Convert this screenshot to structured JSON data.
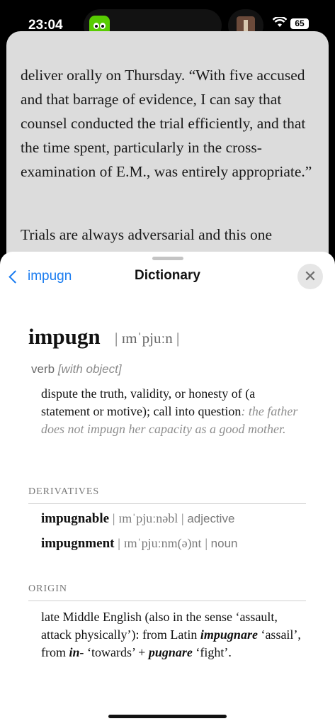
{
  "status": {
    "time": "23:04",
    "battery": "65"
  },
  "article": {
    "p1": "deliver orally on Thursday. “With five accused and that barrage of evidence, I can say that counsel conducted the trial efficiently, and that the time spent, particularly in the cross-examination of E.M., was entirely appropriate.”",
    "p2": "Trials are always adversarial and this one"
  },
  "sheet": {
    "back_label": "impugn",
    "title": "Dictionary",
    "headword": "impugn",
    "pronunciation": "| ɪmˈpjuːn |",
    "part_of_speech": "verb",
    "grammar": "[with object]",
    "definition": "dispute the truth, validity, or honesty of (a statement or motive); call into question",
    "example": ": the father does not impugn her capacity as a good mother.",
    "derivatives_heading": "DERIVATIVES",
    "derivatives": [
      {
        "word": "impugnable",
        "pron": "ɪmˈpjuːnəbl",
        "pos": "adjective"
      },
      {
        "word": "impugnment",
        "pron": "ɪmˈpjuːnm(ə)nt",
        "pos": "noun"
      }
    ],
    "origin_heading": "ORIGIN",
    "origin": {
      "t1": "late Middle English (also in the sense ‘assault, attack physically’): from Latin ",
      "w1": "impugnare",
      "t2": " ‘assail’, from ",
      "w2": "in-",
      "t3": " ‘towards’ + ",
      "w3": "pugnare",
      "t4": " ‘fight’."
    }
  },
  "icons": [
    "wifi-icon",
    "battery-icon",
    "chevron-left-icon",
    "close-icon",
    "duolingo-icon",
    "now-playing-artwork"
  ]
}
